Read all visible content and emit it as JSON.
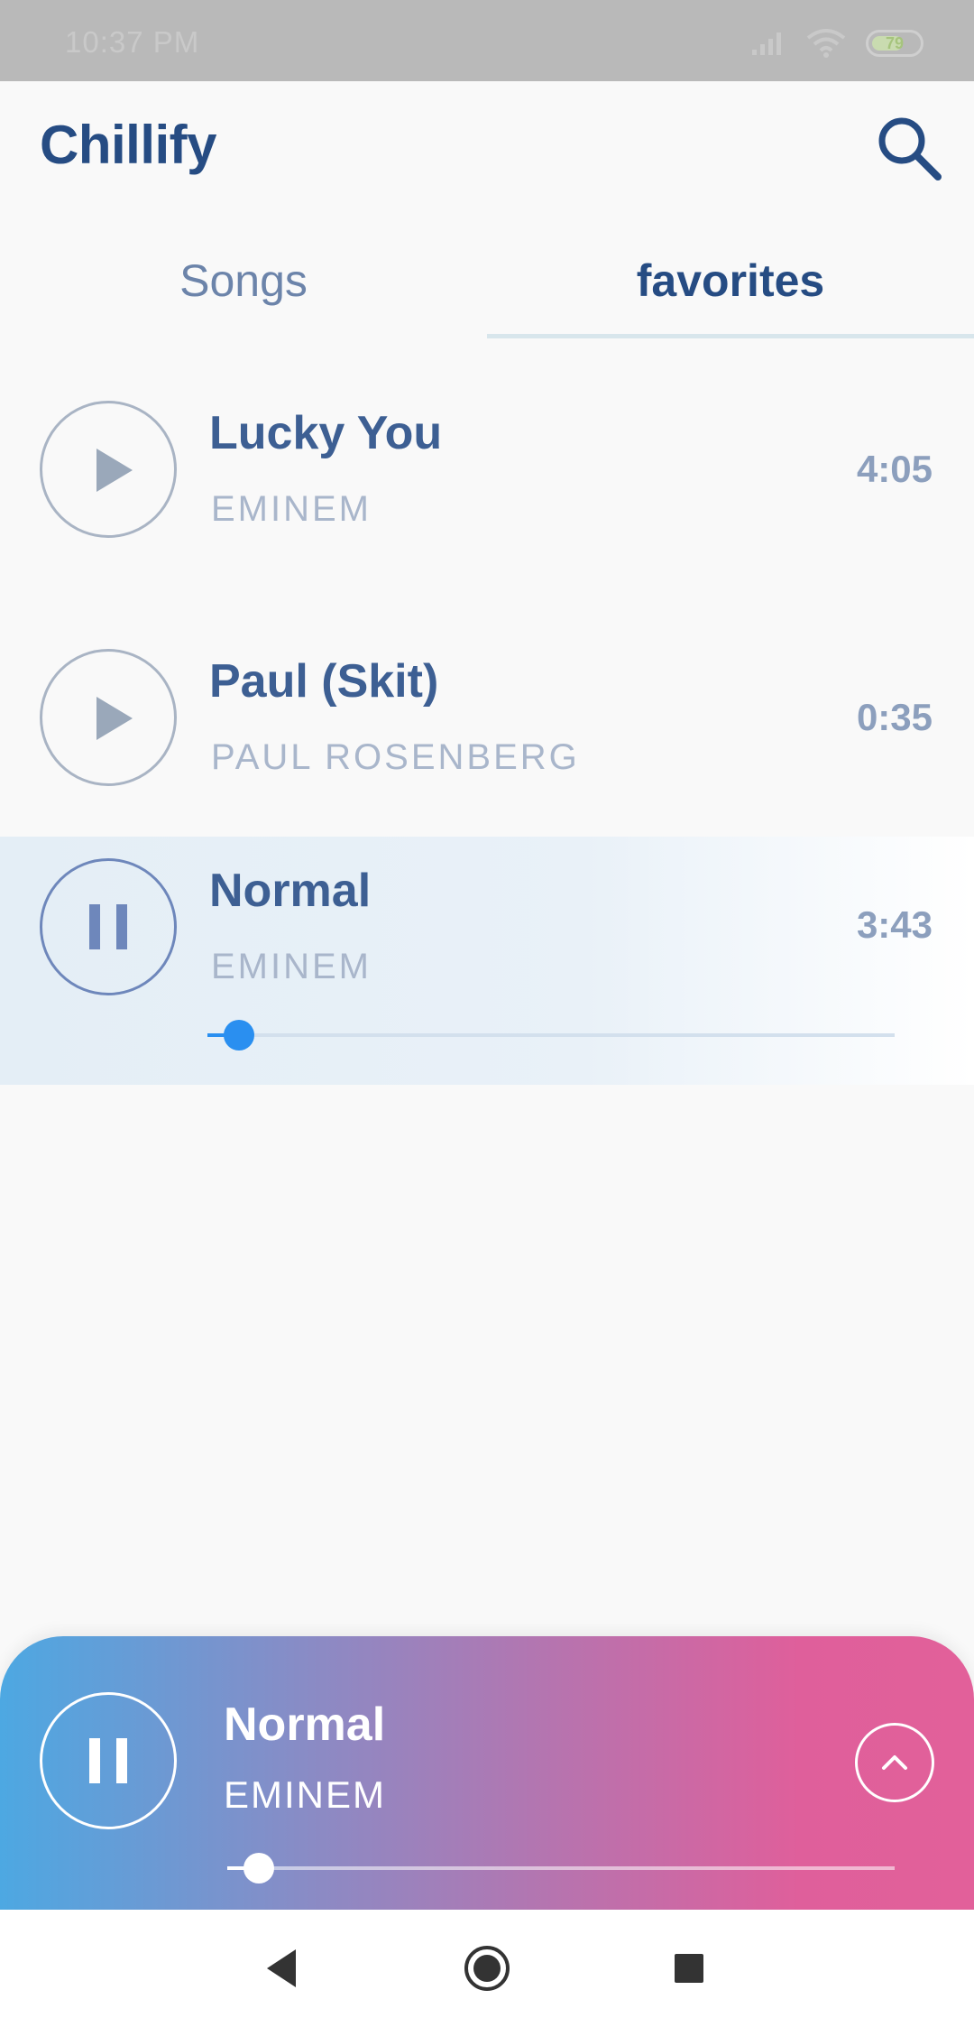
{
  "status_bar": {
    "time": "10:37 PM",
    "battery": "79"
  },
  "app": {
    "title": "Chillify"
  },
  "header": {
    "search_icon": "search-icon"
  },
  "tabs": [
    {
      "label": "Songs",
      "selected": false
    },
    {
      "label": "favorites",
      "selected": true
    }
  ],
  "songs": [
    {
      "title": "Lucky You",
      "artist": "EMINEM",
      "duration": "4:05",
      "state": "paused"
    },
    {
      "title": "Paul (Skit)",
      "artist": "PAUL ROSENBERG",
      "duration": "0:35",
      "state": "paused"
    },
    {
      "title": "Normal",
      "artist": "EMINEM",
      "duration": "3:43",
      "state": "playing",
      "progress": 0.05
    }
  ],
  "now_playing": {
    "title": "Normal",
    "artist": "EMINEM",
    "progress": 0.05,
    "expand_icon": "chevron-up-icon"
  },
  "nav": {
    "back_icon": "back-icon",
    "home_icon": "home-icon",
    "recents_icon": "recents-icon"
  },
  "colors": {
    "brand": "#264c83",
    "accent": "#2a8ff0",
    "gradient_start": "#4da8e2",
    "gradient_end": "#e2609a"
  }
}
